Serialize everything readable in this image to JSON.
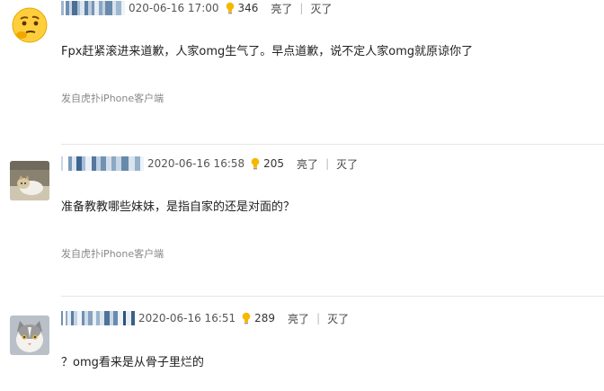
{
  "comments": [
    {
      "time": "020-06-16 17:00",
      "likes": "346",
      "agree": "亮了",
      "disagree": "灭了",
      "text": "Fpx赶紧滚进来道歉，人家omg生气了。早点道歉，说不定人家omg就原谅你了",
      "source": "发自虎扑iPhone客户端"
    },
    {
      "time": "2020-06-16 16:58",
      "likes": "205",
      "agree": "亮了",
      "disagree": "灭了",
      "text": "准备教教哪些妹妹，是指自家的还是对面的？",
      "source": "发自虎扑iPhone客户端"
    },
    {
      "time": "2020-06-16 16:51",
      "likes": "289",
      "agree": "亮了",
      "disagree": "灭了",
      "text": "？omg看来是从骨子里烂的"
    }
  ],
  "separator": "|",
  "colors": {
    "bulb": "#f5b800",
    "divider": "#e6e6e6"
  },
  "icons": [
    "thinking-emoji-avatar",
    "cat-avatar",
    "cat-avatar",
    "lightbulb-icon"
  ]
}
